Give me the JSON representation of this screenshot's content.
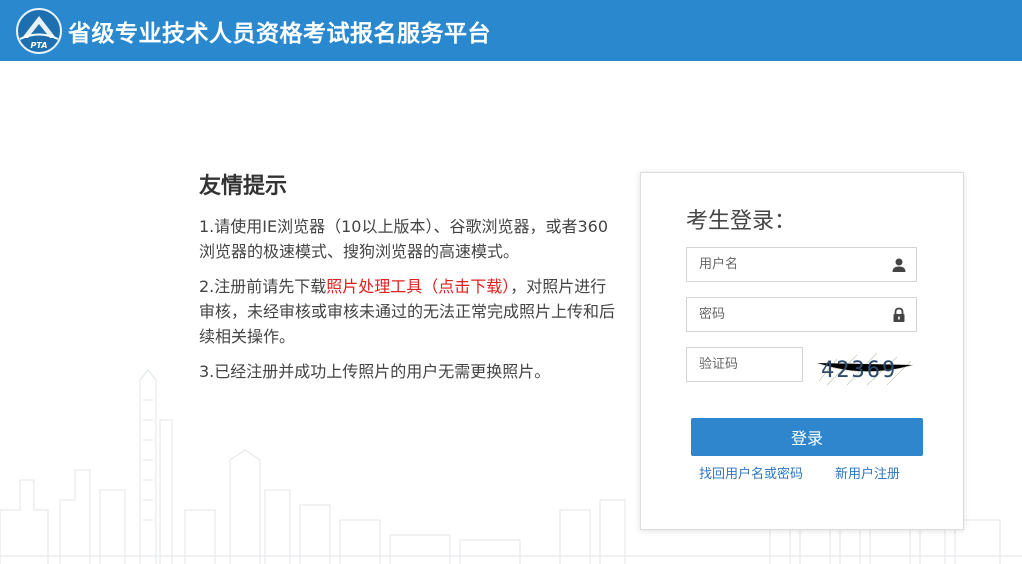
{
  "header": {
    "logo_text": "PTA",
    "title": "省级专业技术人员资格考试报名服务平台"
  },
  "tips": {
    "title": "友情提示",
    "items": [
      {
        "text": "1.请使用IE浏览器（10以上版本）、谷歌浏览器，或者360浏览器的极速模式、搜狗浏览器的高速模式。"
      },
      {
        "prefix": "2.注册前请先下载",
        "link": "照片处理工具（点击下载）",
        "suffix": "，对照片进行审核，未经审核或审核未通过的无法正常完成照片上传和后续相关操作。"
      },
      {
        "text": "3.已经注册并成功上传照片的用户无需更换照片。"
      }
    ]
  },
  "login": {
    "title": "考生登录：",
    "username_placeholder": "用户名",
    "password_placeholder": "密码",
    "captcha_placeholder": "验证码",
    "captcha_value": "42369",
    "submit_label": "登录",
    "forgot_link": "找回用户名或密码",
    "register_link": "新用户注册"
  },
  "colors": {
    "header_bg": "#2a88cf",
    "button_bg": "#2f86cc",
    "link": "#2f76c0",
    "highlight": "#e02020"
  }
}
